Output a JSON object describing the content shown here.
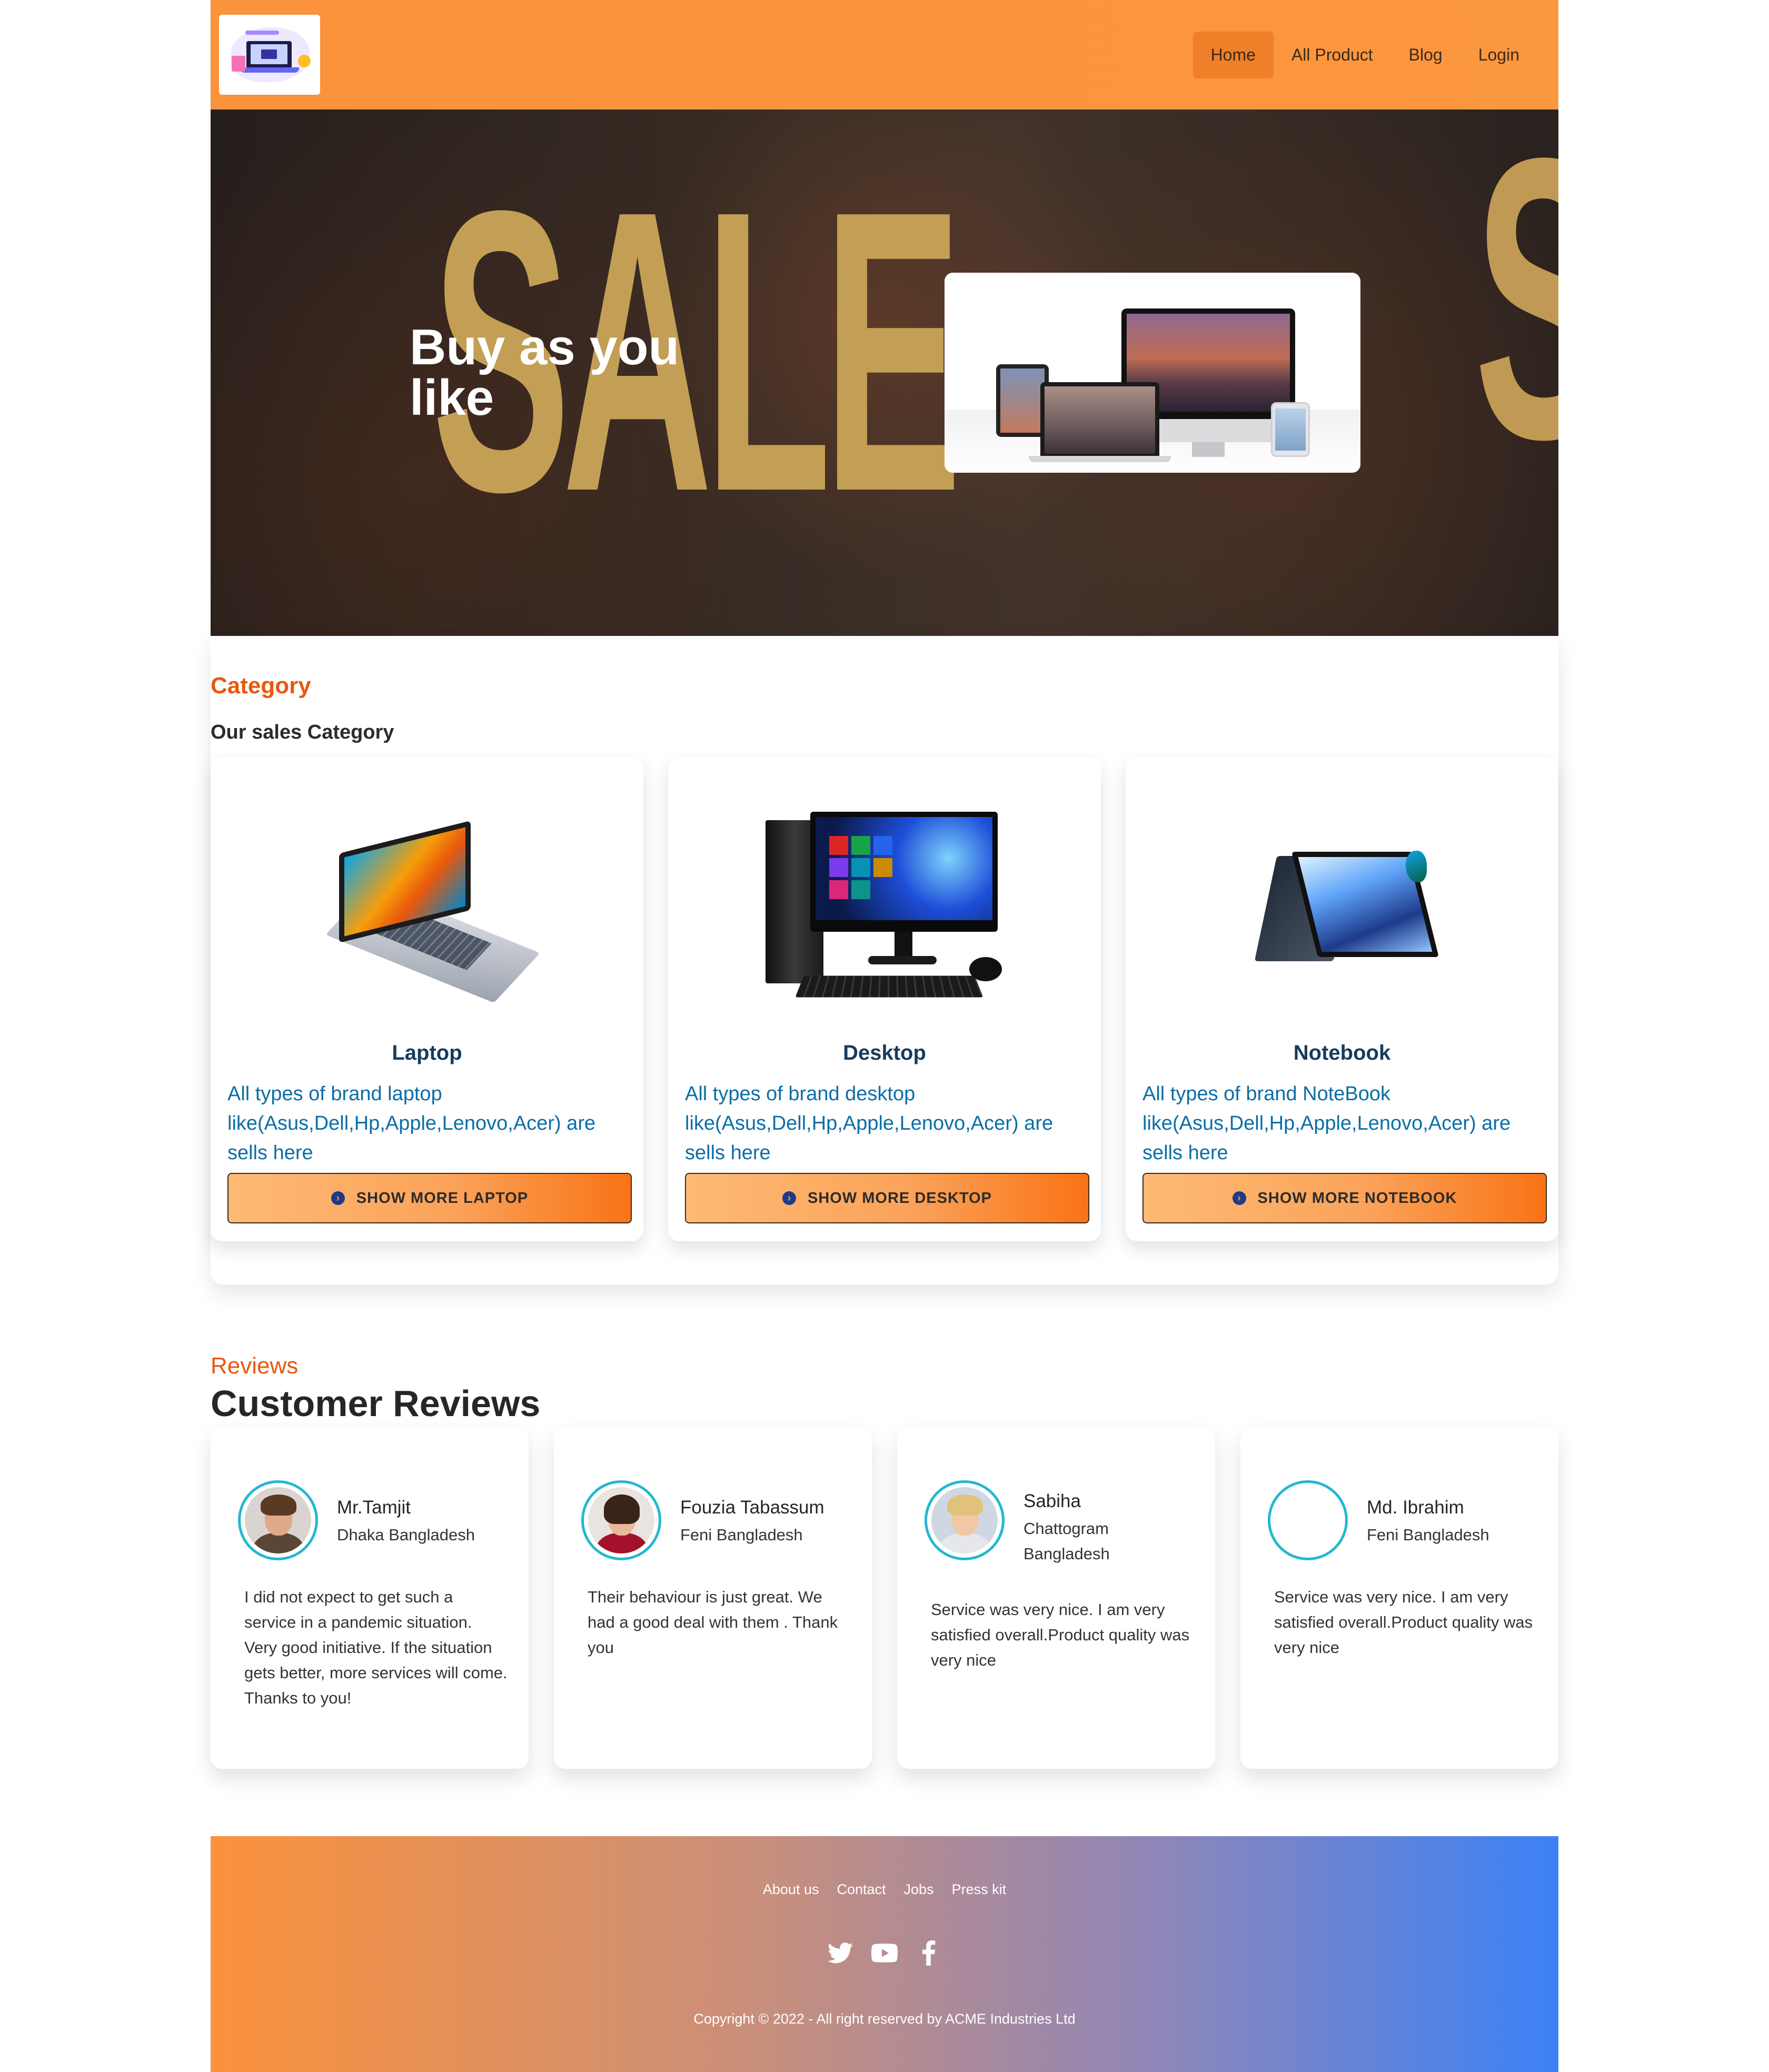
{
  "nav": {
    "logo_alt": "shop logo",
    "links": [
      {
        "label": "Home",
        "active": true
      },
      {
        "label": "All Product",
        "active": false
      },
      {
        "label": "Blog",
        "active": false
      },
      {
        "label": "Login",
        "active": false
      }
    ]
  },
  "hero": {
    "background_text": "SALE",
    "title": "Buy as you like"
  },
  "category": {
    "eyebrow": "Category",
    "subtitle": "Our sales Category",
    "items": [
      {
        "name": "Laptop",
        "description": "All types of brand laptop like(Asus,Dell,Hp,Apple,Lenovo,Acer) are sells here",
        "button": "SHOW MORE LAPTOP",
        "icon": "arrow-circle-right-icon"
      },
      {
        "name": "Desktop",
        "description": "All types of brand desktop like(Asus,Dell,Hp,Apple,Lenovo,Acer) are sells here",
        "button": "SHOW MORE DESKTOP",
        "icon": "arrow-circle-right-icon"
      },
      {
        "name": "Notebook",
        "description": "All types of brand NoteBook like(Asus,Dell,Hp,Apple,Lenovo,Acer) are sells here",
        "button": "SHOW MORE NOTEBOOK",
        "icon": "arrow-circle-right-icon"
      }
    ]
  },
  "reviews": {
    "eyebrow": "Reviews",
    "title": "Customer Reviews",
    "items": [
      {
        "name": "Mr.Tamjit",
        "location": "Dhaka Bangladesh",
        "text": "I did not expect to get such a service in a pandemic situation. Very good initiative. If the situation gets better, more services will come. Thanks to you!"
      },
      {
        "name": "Fouzia Tabassum",
        "location": "Feni Bangladesh",
        "text": "Their behaviour is just great. We had a good deal with them . Thank you"
      },
      {
        "name": "Sabiha",
        "location": "Chattogram Bangladesh",
        "text": "Service was very nice. I am very satisfied overall.Product quality was very nice"
      },
      {
        "name": "Md. Ibrahim",
        "location": "Feni Bangladesh",
        "text": "Service was very nice. I am very satisfied overall.Product quality was very nice"
      }
    ]
  },
  "footer": {
    "links": [
      "About us",
      "Contact",
      "Jobs",
      "Press kit"
    ],
    "social_icons": [
      "twitter-icon",
      "youtube-icon",
      "facebook-icon"
    ],
    "copyright": "Copyright © 2022 - All right reserved by ACME Industries Ltd"
  },
  "colors": {
    "navbar": "#fb923c",
    "accent": "#ea580c",
    "avatar_ring": "#22b8cf",
    "category_text": "#0b6ea6",
    "footer_end": "#3b82f6"
  }
}
